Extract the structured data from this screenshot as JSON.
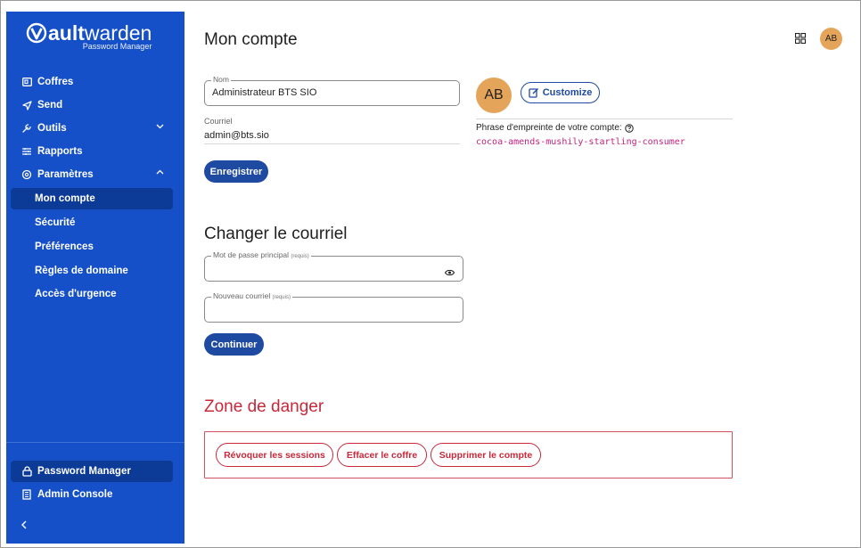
{
  "brand": {
    "name_bold": "ault",
    "name_light": "warden",
    "subtitle": "Password Manager"
  },
  "sidebar": {
    "items": [
      {
        "label": "Coffres",
        "icon": "vault-icon"
      },
      {
        "label": "Send",
        "icon": "send-icon"
      },
      {
        "label": "Outils",
        "icon": "tools-icon",
        "chevron": "down"
      },
      {
        "label": "Rapports",
        "icon": "reports-icon"
      },
      {
        "label": "Paramètres",
        "icon": "gear-icon",
        "chevron": "up"
      }
    ],
    "sub_items": [
      {
        "label": "Mon compte",
        "active": true
      },
      {
        "label": "Sécurité"
      },
      {
        "label": "Préférences"
      },
      {
        "label": "Règles de domaine"
      },
      {
        "label": "Accès d'urgence"
      }
    ],
    "bottom_items": [
      {
        "label": "Password Manager",
        "icon": "lock-icon",
        "selected": true
      },
      {
        "label": "Admin Console",
        "icon": "building-icon"
      }
    ],
    "collapse_icon": "chevron-left-icon"
  },
  "header": {
    "title": "Mon compte",
    "avatar_initials": "AB",
    "apps_icon": "grid-icon"
  },
  "profile": {
    "name_label": "Nom",
    "name_value": "Administrateur BTS SIO",
    "email_label": "Courriel",
    "email_value": "admin@bts.sio",
    "save_button": "Enregistrer",
    "avatar_initials": "AB",
    "customize_button": "Customize",
    "fingerprint_label": "Phrase d'empreinte de votre compte:",
    "fingerprint_value": "cocoa-amends-mushily-startling-consumer"
  },
  "change_email": {
    "title": "Changer le courriel",
    "password_label": "Mot de passe principal",
    "email_label": "Nouveau courriel",
    "required_tag": "(requis)",
    "continue_button": "Continuer"
  },
  "danger_zone": {
    "title": "Zone de danger",
    "buttons": [
      "Révoquer les sessions",
      "Effacer le coffre",
      "Supprimer le compte"
    ]
  },
  "colors": {
    "sidebar_bg": "#1550c8",
    "sidebar_active": "#0c3a97",
    "primary": "#1e4aa1",
    "danger": "#c8283a",
    "avatar": "#e4a55b",
    "fingerprint": "#c0237f"
  }
}
